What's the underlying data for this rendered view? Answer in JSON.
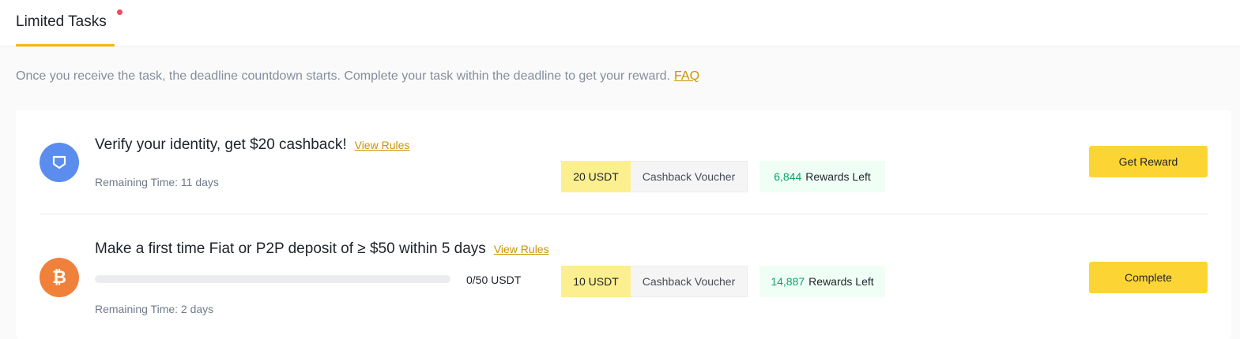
{
  "tabs": [
    {
      "label": "Limited Tasks",
      "active": true,
      "has_notification_dot": true
    }
  ],
  "intro": {
    "text": "Once you receive the task, the deadline countdown starts. Complete your task within the deadline to get your reward.",
    "faq_link": "FAQ"
  },
  "tasks": [
    {
      "icon": "shield-icon",
      "icon_color": "#5b8def",
      "title": "Verify your identity, get $20 cashback!",
      "rules_link": "View Rules",
      "remaining": "Remaining Time: 11 days",
      "reward_amount": "20 USDT",
      "reward_type": "Cashback Voucher",
      "rewards_left_count": "6,844",
      "rewards_left_label": "Rewards Left",
      "action_label": "Get Reward"
    },
    {
      "icon": "bitcoin-icon",
      "icon_color": "#f0813a",
      "title": "Make a first time Fiat or P2P deposit of ≥ $50 within 5 days",
      "rules_link": "View Rules",
      "progress_text": "0/50 USDT",
      "progress_fraction": 0,
      "remaining": "Remaining Time: 2 days",
      "reward_amount": "10 USDT",
      "reward_type": "Cashback Voucher",
      "rewards_left_count": "14,887",
      "rewards_left_label": "Rewards Left",
      "action_label": "Complete"
    }
  ],
  "colors": {
    "accent_yellow": "#fcd535",
    "link_gold": "#c99400",
    "rewards_green": "#03a66d",
    "notification_red": "#f6465d"
  }
}
